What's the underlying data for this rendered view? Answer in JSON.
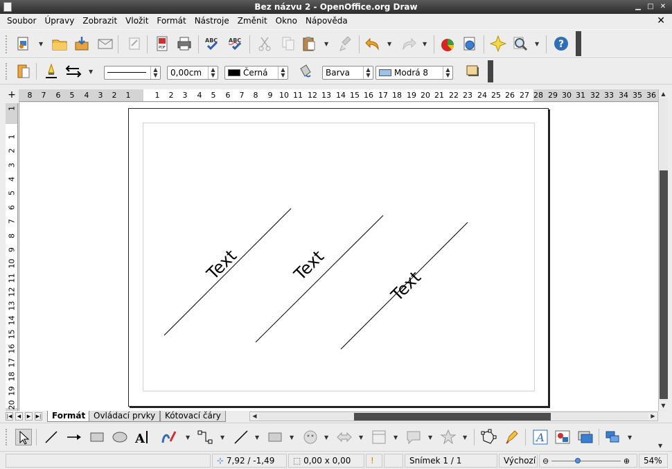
{
  "window": {
    "title": "Bez názvu 2 - OpenOffice.org Draw"
  },
  "menu": {
    "items": [
      "Soubor",
      "Úpravy",
      "Zobrazit",
      "Vložit",
      "Formát",
      "Nástroje",
      "Změnit",
      "Okno",
      "Nápověda"
    ],
    "close_glyph": "✕"
  },
  "line_toolbar": {
    "line_width": "0,00cm",
    "line_color": "Černá",
    "area_style": "Barva",
    "area_color": "Modrá 8",
    "line_color_hex": "#000000",
    "area_color_hex": "#9bc3e9"
  },
  "rulers": {
    "horizontal": [
      "8",
      "7",
      "6",
      "5",
      "4",
      "3",
      "2",
      "1",
      "1",
      "2",
      "3",
      "4",
      "5",
      "6",
      "7",
      "8",
      "9",
      "10",
      "11",
      "12",
      "13",
      "14",
      "15",
      "16",
      "17",
      "18",
      "19",
      "20",
      "21",
      "22",
      "23",
      "24",
      "25",
      "26",
      "27",
      "28",
      "29",
      "30",
      "31",
      "32",
      "33",
      "34",
      "35",
      "36"
    ],
    "vertical": [
      "1",
      "1",
      "2",
      "3",
      "4",
      "5",
      "6",
      "7",
      "8",
      "9",
      "10",
      "11",
      "12",
      "13",
      "14",
      "15",
      "16",
      "17",
      "18",
      "19",
      "20"
    ]
  },
  "canvas": {
    "shapes": [
      {
        "label": "Text"
      },
      {
        "label": "Text"
      },
      {
        "label": "Text"
      }
    ]
  },
  "tabs": [
    {
      "label": "Formát",
      "active": true
    },
    {
      "label": "Ovládací prvky",
      "active": false
    },
    {
      "label": "Kótovací čáry",
      "active": false
    }
  ],
  "status": {
    "position": "7,92 / -1,49",
    "size": "0,00 x 0,00",
    "slide": "Snímek 1 / 1",
    "master": "Výchozí",
    "zoom": "54%"
  },
  "icons": {
    "standard": [
      "new-icon",
      "open-icon",
      "save-icon",
      "email-icon",
      "edit-file-icon",
      "export-pdf-icon",
      "print-icon",
      "spellcheck-icon",
      "autospellcheck-icon",
      "cut-icon",
      "copy-icon",
      "paste-icon",
      "clone-format-icon",
      "undo-icon",
      "redo-icon",
      "chart-icon",
      "navigator-icon",
      "gallery-icon",
      "zoom-icon",
      "help-icon"
    ],
    "drawing": [
      "select-icon",
      "line-icon",
      "arrow-line-icon",
      "rectangle-icon",
      "ellipse-icon",
      "fontwork-text-icon",
      "curve-icon",
      "connector-icon",
      "lines-arrows-icon",
      "basic-shapes-icon",
      "symbol-shapes-icon",
      "block-arrows-icon",
      "flowchart-icon",
      "callouts-icon",
      "stars-icon",
      "points-icon",
      "glue-points-icon",
      "fontwork-gallery-icon",
      "from-file-icon",
      "extrusion-icon",
      "align-icon"
    ]
  }
}
